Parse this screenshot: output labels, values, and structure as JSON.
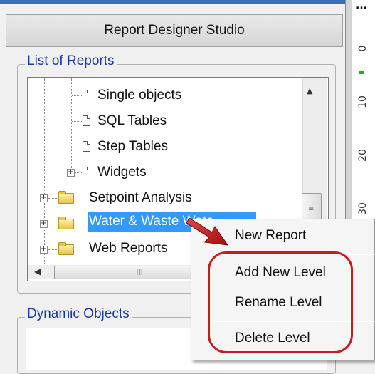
{
  "header": {
    "title": "Report Designer Studio"
  },
  "reports_group": {
    "legend": "List of Reports",
    "tree": {
      "items": [
        {
          "label": "Single objects",
          "kind": "document",
          "expandable": false
        },
        {
          "label": "SQL Tables",
          "kind": "document",
          "expandable": false
        },
        {
          "label": "Step Tables",
          "kind": "document",
          "expandable": false
        },
        {
          "label": "Widgets",
          "kind": "document",
          "expandable": true
        },
        {
          "label": "Setpoint Analysis",
          "kind": "folder",
          "expandable": true
        },
        {
          "label": "Water & Waste Wate",
          "kind": "folder",
          "expandable": true,
          "selected": true
        },
        {
          "label": "Web Reports",
          "kind": "folder",
          "expandable": true
        }
      ],
      "expander_glyph": "+",
      "scroll_up_glyph": "▲",
      "scroll_left_glyph": "◀",
      "hscroll_grip": "III",
      "vscroll_grip": "≡"
    }
  },
  "dynamic_group": {
    "legend": "Dynamic Objects"
  },
  "context_menu": {
    "items": [
      {
        "label": "New Report"
      },
      {
        "label": "Add New Level"
      },
      {
        "label": "Rename Level"
      },
      {
        "label": "Delete Level"
      }
    ]
  },
  "ruler": {
    "labels": [
      "0",
      "10",
      "20",
      "30"
    ],
    "top_marker": "..."
  },
  "colors": {
    "selection": "#3399ff",
    "annotation": "#c41d1d",
    "legend_text": "#1a37a8"
  },
  "icons": [
    "document-icon",
    "folder-icon",
    "expand-icon",
    "scroll-up-icon",
    "scroll-left-icon",
    "red-arrow-icon"
  ]
}
